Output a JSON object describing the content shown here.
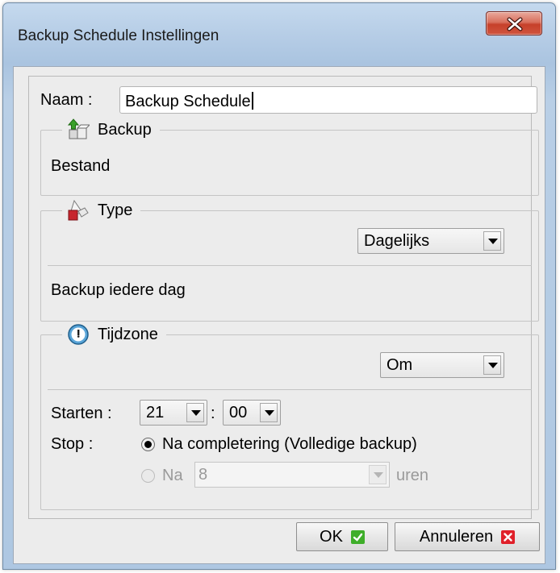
{
  "window": {
    "title": "Backup Schedule Instellingen"
  },
  "naam": {
    "label": "Naam :",
    "value": "Backup Schedule"
  },
  "backup_group": {
    "legend": "Backup",
    "icon": "backup-up-arrow-icon",
    "value": "Bestand"
  },
  "type_group": {
    "legend": "Type",
    "icon": "type-shapes-icon",
    "frequency": "Dagelijks",
    "description": "Backup iedere dag"
  },
  "tijdzone_group": {
    "legend": "Tijdzone",
    "icon": "clock-icon",
    "mode": "Om",
    "start_label": "Starten :",
    "start_hour": "21",
    "time_separator": ":",
    "start_minute": "00",
    "stop_label": "Stop :",
    "stop_option_complete": "Na completering (Volledige backup)",
    "stop_option_after_prefix": "Na",
    "stop_option_after_value": "8",
    "stop_option_after_unit": "uren",
    "stop_selected": "complete"
  },
  "buttons": {
    "ok": "OK",
    "cancel": "Annuleren"
  },
  "colors": {
    "ok_icon": "#3fae2a",
    "cancel_icon": "#e0202a",
    "close_button": "#c6402a"
  }
}
